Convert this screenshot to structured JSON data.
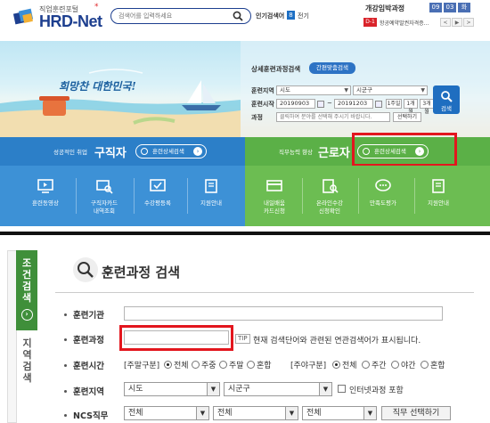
{
  "header": {
    "logo_sub": "직업훈련포털",
    "logo_main": "HRD-Net",
    "search_placeholder": "검색어를 입력하세요",
    "popular_label": "인기검색어 :",
    "popular_rank": "8",
    "popular_term": "전기"
  },
  "calendar": {
    "title": "개강임박과정",
    "dates": [
      "09",
      "03",
      "화"
    ],
    "dday": "D-1",
    "course": "항공예약발권자격증...",
    "pager": [
      "<",
      "▶",
      ">"
    ]
  },
  "banner": {
    "slogan": "희망찬 대한민국!",
    "title": "상세훈련과정검색",
    "simple_search": "간편맞춤검색",
    "region_label": "훈련지역",
    "region_value": "시도",
    "district_value": "시군구",
    "period_label": "훈련시작",
    "date_from": "20190903",
    "date_to": "20191203",
    "tilde": "~",
    "period_buttons": [
      "1주일",
      "1개월",
      "3개월"
    ],
    "course_label": "과정",
    "course_placeholder": "클릭하여 분야를 선택해 주시기 바랍니다.",
    "select_button": "선택하기",
    "search_button": "검색"
  },
  "seeker": {
    "small": "성공적인 취업",
    "big": "구직자",
    "button": "훈련상세검색",
    "items": [
      {
        "label": "훈련동영상"
      },
      {
        "label": "구직자카드\n내역조회"
      },
      {
        "label": "수강평등록"
      },
      {
        "label": "지원안내"
      }
    ]
  },
  "worker": {
    "small": "직무능력 향상",
    "big": "근로자",
    "button": "훈련상세검색",
    "items": [
      {
        "label": "내일배움\n카드신청"
      },
      {
        "label": "온라인수강\n신청확인"
      },
      {
        "label": "만족도평가"
      },
      {
        "label": "지원안내"
      }
    ]
  },
  "lower": {
    "tab_condition": "조건검색",
    "tab_area": "지역검색",
    "title": "훈련과정 검색",
    "rows": {
      "institution_label": "훈련기관",
      "course_label": "훈련과정",
      "tip": "TIP",
      "tip_text": "현재 검색단어와 관련된 연관검색어가 표시됩니다.",
      "time_label": "훈련시간",
      "weekday_group": "[주말구분]",
      "weekday_options": [
        "전체",
        "주중",
        "주말",
        "혼합"
      ],
      "day_group": "[주야구분]",
      "day_options": [
        "전체",
        "주간",
        "야간",
        "혼합"
      ],
      "region_label": "훈련지역",
      "region_value": "시도",
      "district_value": "시군구",
      "internet_label": "인터넷과정 포함",
      "ncs_label": "NCS직무",
      "ncs_values": [
        "전체",
        "전체",
        "전체"
      ],
      "job_button": "직무 선택하기"
    }
  }
}
